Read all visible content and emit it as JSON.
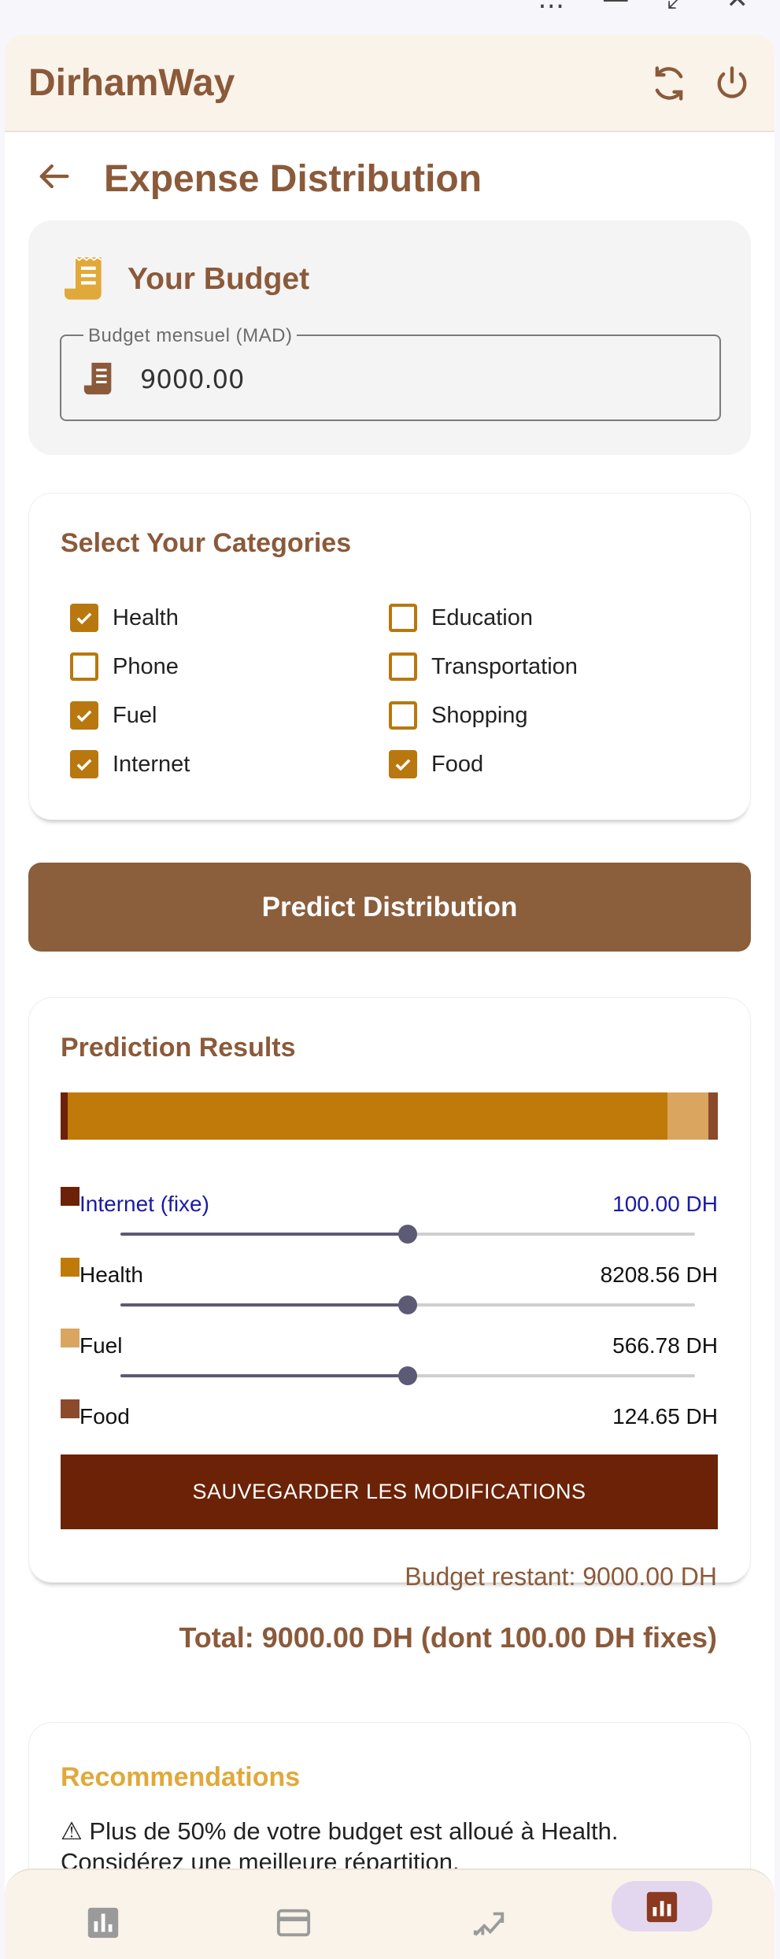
{
  "window_controls": [
    "…",
    "—",
    "⤢",
    "✕"
  ],
  "app": {
    "title": "DirhamWay",
    "icons": [
      "refresh-icon",
      "power-icon"
    ]
  },
  "page": {
    "title": "Expense Distribution"
  },
  "budget": {
    "title": "Your Budget",
    "field_label": "Budget mensuel (MAD)",
    "field_value": "9000.00"
  },
  "categories": {
    "title": "Select Your Categories",
    "items": [
      {
        "label": "Health",
        "checked": true
      },
      {
        "label": "Education",
        "checked": false
      },
      {
        "label": "Phone",
        "checked": false
      },
      {
        "label": "Transportation",
        "checked": false
      },
      {
        "label": "Fuel",
        "checked": true
      },
      {
        "label": "Shopping",
        "checked": false
      },
      {
        "label": "Internet",
        "checked": true
      },
      {
        "label": "Food",
        "checked": true
      }
    ]
  },
  "predict_button": "Predict Distribution",
  "results": {
    "title": "Prediction Results",
    "rows": [
      {
        "label": "Internet (fixe)",
        "value": "100.00 DH",
        "color": "#6b2206",
        "amount": 100.0,
        "fixed": true
      },
      {
        "label": "Health",
        "value": "8208.56 DH",
        "color": "#c07a0a",
        "amount": 8208.56,
        "slider": 0.5
      },
      {
        "label": "Fuel",
        "value": "566.78 DH",
        "color": "#d9a55f",
        "amount": 566.78,
        "slider": 0.5
      },
      {
        "label": "Food",
        "value": "124.65 DH",
        "color": "#8b4a2b",
        "amount": 124.65,
        "slider": 0.5
      }
    ],
    "save_button": "SAUVEGARDER LES MODIFICATIONS",
    "remaining": "Budget restant: 9000.00 DH",
    "total": "Total: 9000.00 DH (dont 100.00 DH fixes)"
  },
  "recommendations": {
    "title": "Recommendations",
    "text": "⚠ Plus de 50% de votre budget est alloué à Health. Considérez une meilleure répartition."
  },
  "nav": [
    {
      "icon": "bar-chart-icon",
      "active": false
    },
    {
      "icon": "credit-card-icon",
      "active": false
    },
    {
      "icon": "trending-up-icon",
      "active": false
    },
    {
      "icon": "analytics-icon",
      "active": true
    }
  ],
  "colors": {
    "brand": "#8b5a3a",
    "accent": "#b8780f",
    "save": "#6b2206",
    "recommendation": "#e0a93a"
  }
}
